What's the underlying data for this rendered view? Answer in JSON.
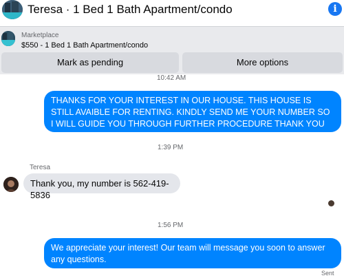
{
  "header": {
    "title": "Teresa · 1 Bed 1 Bath Apartment/condo",
    "info_icon": "i"
  },
  "marketplace": {
    "label": "Marketplace",
    "listing": "$550 - 1 Bed 1 Bath Apartment/condo",
    "mark_pending_label": "Mark as pending",
    "more_options_label": "More options"
  },
  "thread": {
    "clipped_time": "10:42 AM",
    "messages": [
      {
        "direction": "outgoing",
        "text": "THANKS FOR YOUR INTEREST IN OUR HOUSE. THIS HOUSE IS STILL AVAIBLE FOR RENTING. KINDLY SEND ME YOUR NUMBER SO I WILL GUIDE YOU THROUGH FURTHER PROCEDURE THANK YOU HAVE A NICE DAY!"
      },
      {
        "direction": "timestamp",
        "text": "1:39 PM"
      },
      {
        "direction": "incoming",
        "sender": "Teresa",
        "text": "Thank you, my number is 562-419-5836"
      },
      {
        "direction": "timestamp",
        "text": "1:56 PM"
      },
      {
        "direction": "outgoing",
        "text": "We appreciate your interest! Our team will message you soon to answer any questions.",
        "status": "Sent"
      }
    ]
  },
  "colors": {
    "outgoing_bubble": "#0084ff",
    "incoming_bubble": "#e4e6eb",
    "accent": "#1877f2",
    "panel": "#e9eaed"
  }
}
